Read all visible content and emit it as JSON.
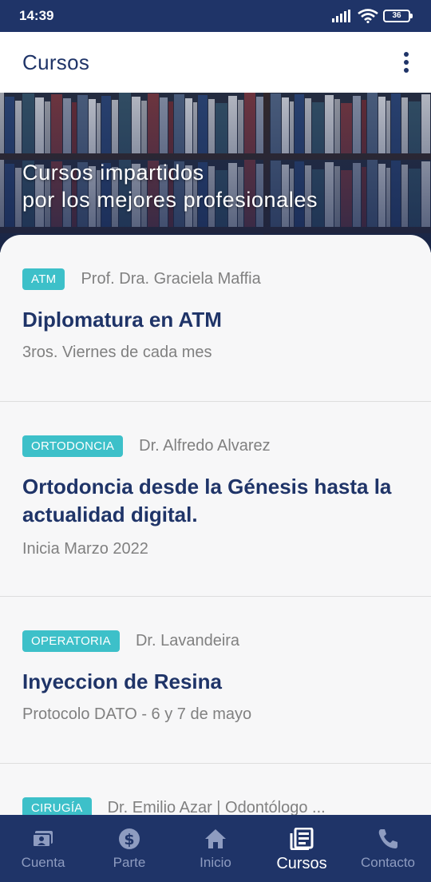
{
  "status_bar": {
    "time": "14:39",
    "battery": "36"
  },
  "app_bar": {
    "title": "Cursos",
    "menu_icon": "more-vert-icon"
  },
  "hero": {
    "line1": "Cursos impartidos",
    "line2": "por los mejores profesionales"
  },
  "courses": [
    {
      "tag": "ATM",
      "professor": "Prof. Dra. Graciela Maffia",
      "title": "Diplomatura en ATM",
      "date": "3ros. Viernes de cada mes"
    },
    {
      "tag": "ORTODONCIA",
      "professor": "Dr. Alfredo Alvarez",
      "title": "Ortodoncia desde la Génesis hasta la actualidad digital.",
      "date": "Inicia Marzo 2022"
    },
    {
      "tag": "OPERATORIA",
      "professor": "Dr. Lavandeira",
      "title": "Inyeccion de Resina",
      "date": "Protocolo DATO - 6 y 7  de mayo"
    },
    {
      "tag": "CIRUGÍA",
      "professor": "Dr. Emilio Azar | Odontólogo ...",
      "title": "",
      "date": ""
    }
  ],
  "nav": [
    {
      "label": "Cuenta",
      "icon": "account-card-icon",
      "active": false
    },
    {
      "label": "Parte",
      "icon": "dollar-circle-icon",
      "active": false
    },
    {
      "label": "Inicio",
      "icon": "home-icon",
      "active": false
    },
    {
      "label": "Cursos",
      "icon": "news-icon",
      "active": true
    },
    {
      "label": "Contacto",
      "icon": "phone-icon",
      "active": false
    }
  ],
  "colors": {
    "primary": "#1f3468",
    "tag": "#3dc0c9",
    "muted": "#808080"
  }
}
